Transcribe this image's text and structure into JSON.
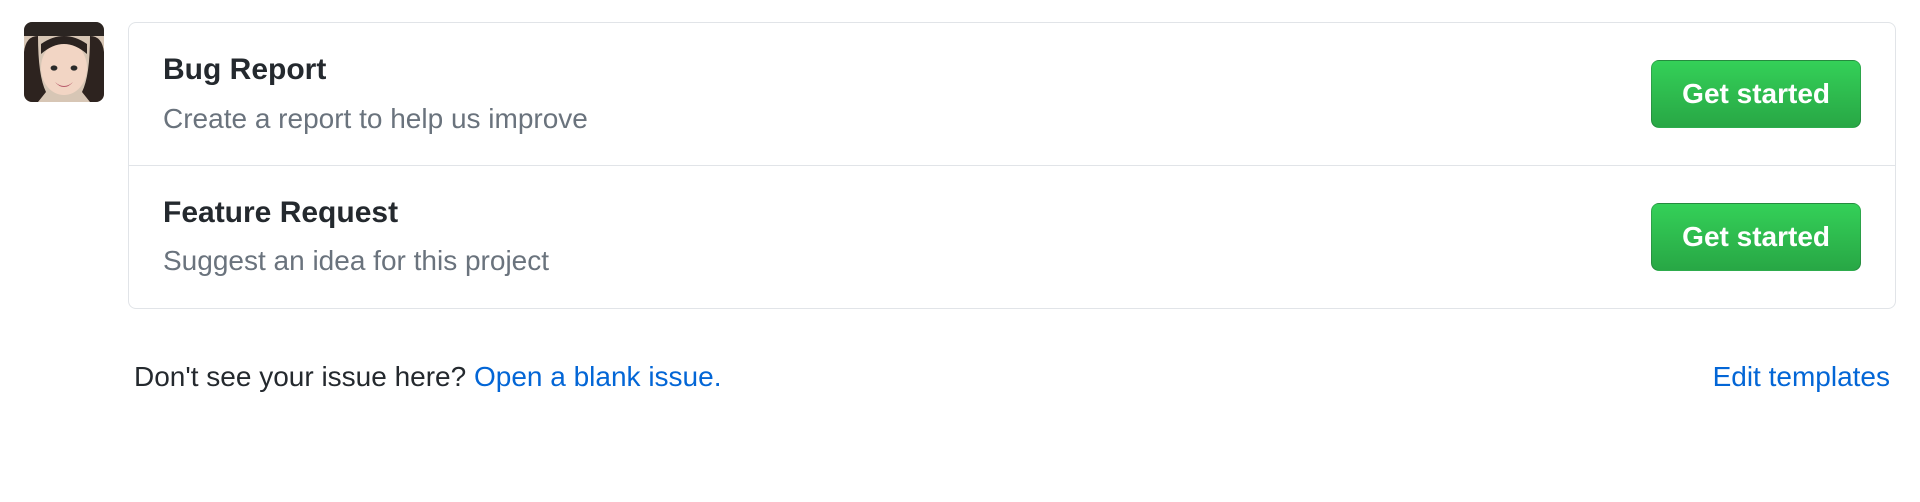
{
  "templates": [
    {
      "title": "Bug Report",
      "description": "Create a report to help us improve",
      "button": "Get started"
    },
    {
      "title": "Feature Request",
      "description": "Suggest an idea for this project",
      "button": "Get started"
    }
  ],
  "footer": {
    "prompt": "Don't see your issue here? ",
    "open_blank": "Open a blank issue.",
    "edit_templates": "Edit templates"
  }
}
